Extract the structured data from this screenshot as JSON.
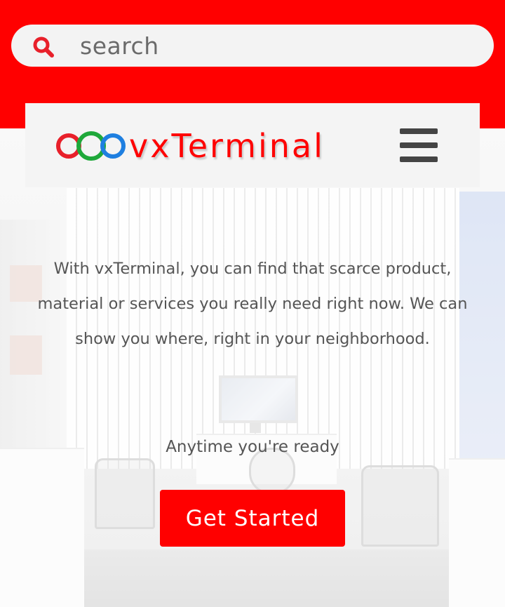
{
  "colors": {
    "brand_red": "#ff0000",
    "ring_red": "#e8202a",
    "ring_green": "#1fa83a",
    "ring_blue": "#1e7fe0",
    "text_gray": "#555555",
    "menu_icon": "#444444"
  },
  "search": {
    "placeholder": "search",
    "icon": "search-icon"
  },
  "header": {
    "logo_text": "vxTerminal",
    "logo_icon": "three-rings-logo",
    "menu_icon": "hamburger-menu-icon"
  },
  "hero": {
    "text": "With vxTerminal, you can find that scarce product, material or services you really need right now. We can show you where, right in your neighborhood.",
    "tagline": "Anytime you're ready",
    "cta_label": "Get Started"
  }
}
